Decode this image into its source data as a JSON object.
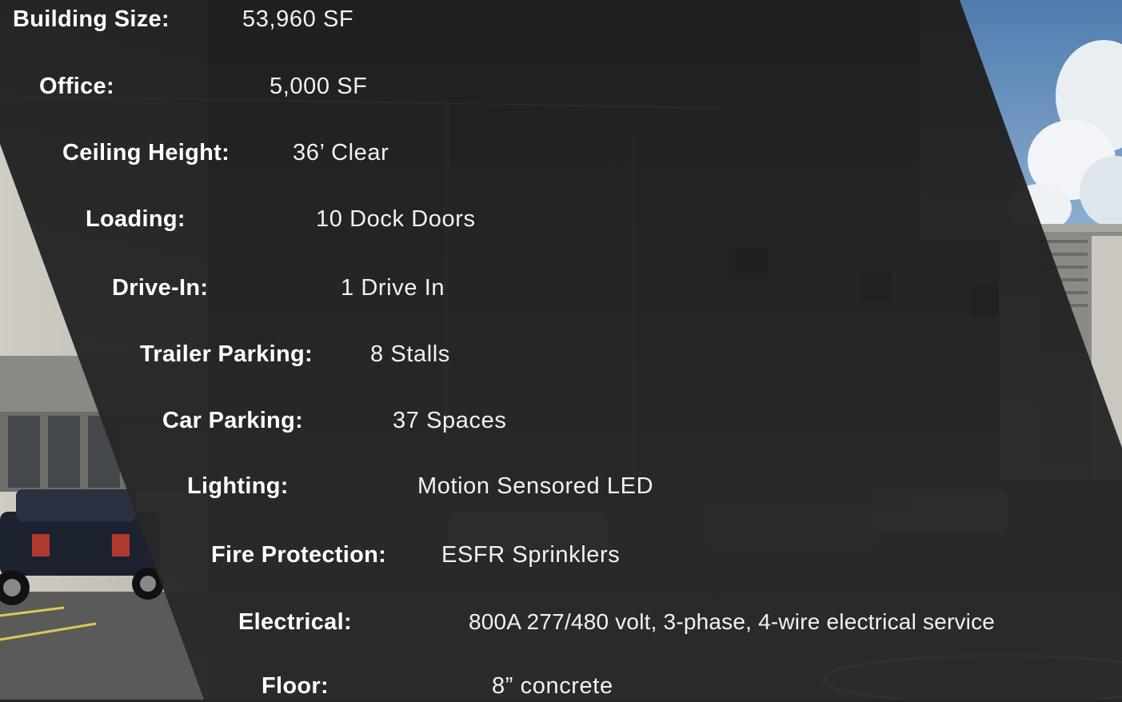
{
  "specs": [
    {
      "label": "Building Size:",
      "value": "53,960 SF"
    },
    {
      "label": "Office:",
      "value": "5,000 SF"
    },
    {
      "label": "Ceiling Height:",
      "value": "36’ Clear"
    },
    {
      "label": "Loading:",
      "value": "10 Dock Doors"
    },
    {
      "label": "Drive-In:",
      "value": "1 Drive In"
    },
    {
      "label": "Trailer Parking:",
      "value": "8 Stalls"
    },
    {
      "label": "Car Parking:",
      "value": "37 Spaces"
    },
    {
      "label": "Lighting:",
      "value": "Motion  Sensored LED"
    },
    {
      "label": "Fire Protection:",
      "value": "ESFR Sprinklers"
    },
    {
      "label": "Electrical:",
      "value": "800A 277/480 volt, 3-phase, 4-wire electrical service"
    },
    {
      "label": "Floor:",
      "value": "8” concrete"
    }
  ],
  "colors": {
    "panel": "#232222",
    "label_text": "#ffffff",
    "value_text": "#f2f2f2",
    "sky": "#5f87b4",
    "building_wall": "#d9d7cf"
  }
}
